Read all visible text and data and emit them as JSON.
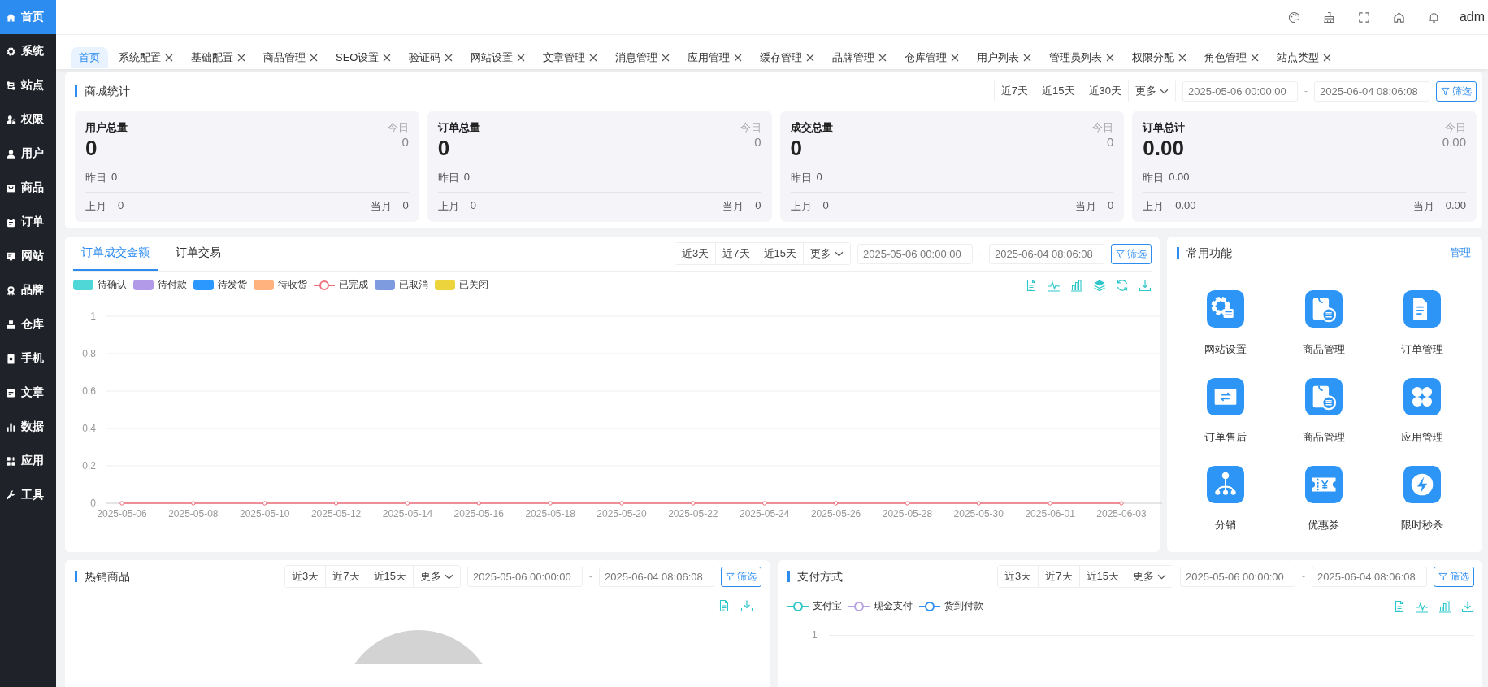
{
  "sidebar": {
    "items": [
      {
        "label": "首页",
        "selected": true
      },
      {
        "label": "系统",
        "selected": false
      },
      {
        "label": "站点",
        "selected": false
      },
      {
        "label": "权限",
        "selected": false
      },
      {
        "label": "用户",
        "selected": false
      },
      {
        "label": "商品",
        "selected": false
      },
      {
        "label": "订单",
        "selected": false
      },
      {
        "label": "网站",
        "selected": false
      },
      {
        "label": "品牌",
        "selected": false
      },
      {
        "label": "仓库",
        "selected": false
      },
      {
        "label": "手机",
        "selected": false
      },
      {
        "label": "文章",
        "selected": false
      },
      {
        "label": "数据",
        "selected": false
      },
      {
        "label": "应用",
        "selected": false
      },
      {
        "label": "工具",
        "selected": false
      }
    ]
  },
  "header": {
    "user": "adm"
  },
  "tabs": [
    {
      "label": "首页",
      "selected": true,
      "closable": false
    },
    {
      "label": "系统配置",
      "selected": false,
      "closable": true
    },
    {
      "label": "基础配置",
      "selected": false,
      "closable": true
    },
    {
      "label": "商品管理",
      "selected": false,
      "closable": true
    },
    {
      "label": "SEO设置",
      "selected": false,
      "closable": true
    },
    {
      "label": "验证码",
      "selected": false,
      "closable": true
    },
    {
      "label": "网站设置",
      "selected": false,
      "closable": true
    },
    {
      "label": "文章管理",
      "selected": false,
      "closable": true
    },
    {
      "label": "消息管理",
      "selected": false,
      "closable": true
    },
    {
      "label": "应用管理",
      "selected": false,
      "closable": true
    },
    {
      "label": "缓存管理",
      "selected": false,
      "closable": true
    },
    {
      "label": "品牌管理",
      "selected": false,
      "closable": true
    },
    {
      "label": "仓库管理",
      "selected": false,
      "closable": true
    },
    {
      "label": "用户列表",
      "selected": false,
      "closable": true
    },
    {
      "label": "管理员列表",
      "selected": false,
      "closable": true
    },
    {
      "label": "权限分配",
      "selected": false,
      "closable": true
    },
    {
      "label": "角色管理",
      "selected": false,
      "closable": true
    },
    {
      "label": "站点类型",
      "selected": false,
      "closable": true
    }
  ],
  "mall_stats": {
    "title": "商城统计",
    "filter": {
      "ranges": [
        "近7天",
        "近15天",
        "近30天"
      ],
      "more": "更多",
      "start": "2025-05-06 00:00:00",
      "separator": "-",
      "end": "2025-06-04 08:06:08",
      "button": "筛选"
    },
    "cards": [
      {
        "title": "用户总量",
        "value": "0",
        "today_label": "今日",
        "today": "0",
        "yesterday_label": "昨日",
        "yesterday": "0",
        "last_month_label": "上月",
        "last_month": "0",
        "this_month_label": "当月",
        "this_month": "0"
      },
      {
        "title": "订单总量",
        "value": "0",
        "today_label": "今日",
        "today": "0",
        "yesterday_label": "昨日",
        "yesterday": "0",
        "last_month_label": "上月",
        "last_month": "0",
        "this_month_label": "当月",
        "this_month": "0"
      },
      {
        "title": "成交总量",
        "value": "0",
        "today_label": "今日",
        "today": "0",
        "yesterday_label": "昨日",
        "yesterday": "0",
        "last_month_label": "上月",
        "last_month": "0",
        "this_month_label": "当月",
        "this_month": "0"
      },
      {
        "title": "订单总计",
        "value": "0.00",
        "today_label": "今日",
        "today": "0.00",
        "yesterday_label": "昨日",
        "yesterday": "0.00",
        "last_month_label": "上月",
        "last_month": "0.00",
        "this_month_label": "当月",
        "this_month": "0.00"
      }
    ]
  },
  "order_chart": {
    "tabs": [
      {
        "label": "订单成交金额",
        "selected": true
      },
      {
        "label": "订单交易",
        "selected": false
      }
    ],
    "filter": {
      "ranges": [
        "近3天",
        "近7天",
        "近15天"
      ],
      "more": "更多",
      "start": "2025-05-06 00:00:00",
      "separator": "-",
      "end": "2025-06-04 08:06:08",
      "button": "筛选"
    },
    "legend": [
      {
        "kind": "swatch",
        "label": "待确认",
        "color": "#4fd6d6"
      },
      {
        "kind": "swatch",
        "label": "待付款",
        "color": "#b39ae8"
      },
      {
        "kind": "swatch",
        "label": "待发货",
        "color": "#2b98ff"
      },
      {
        "kind": "swatch",
        "label": "待收货",
        "color": "#ffb27e"
      },
      {
        "kind": "line"
      },
      {
        "kind": "swatch",
        "label": "已取消",
        "color": "#7f9be0"
      },
      {
        "kind": "swatch",
        "label": "已关闭",
        "color": "#ecd53c"
      }
    ],
    "chart_data": {
      "type": "line",
      "ylim": [
        0,
        1
      ],
      "yticks": [
        0,
        0.2,
        0.4,
        0.6,
        0.8,
        1
      ],
      "grid": true,
      "categories": [
        "2025-05-06",
        "2025-05-08",
        "2025-05-10",
        "2025-05-12",
        "2025-05-14",
        "2025-05-16",
        "2025-05-18",
        "2025-05-20",
        "2025-05-22",
        "2025-05-24",
        "2025-05-26",
        "2025-05-28",
        "2025-05-30",
        "2025-06-01",
        "2025-06-03"
      ],
      "series": [
        {
          "name": "已完成",
          "color": "#f0707e",
          "marker": "circle",
          "values": [
            0,
            0,
            0,
            0,
            0,
            0,
            0,
            0,
            0,
            0,
            0,
            0,
            0,
            0,
            0
          ]
        }
      ]
    }
  },
  "shortcuts": {
    "title": "常用功能",
    "manage_link": "管理",
    "items": [
      {
        "label": "网站设置"
      },
      {
        "label": "商品管理"
      },
      {
        "label": "订单管理"
      },
      {
        "label": "订单售后"
      },
      {
        "label": "商品管理"
      },
      {
        "label": "应用管理"
      },
      {
        "label": "分销"
      },
      {
        "label": "优惠券"
      },
      {
        "label": "限时秒杀"
      }
    ]
  },
  "hot_products": {
    "title": "热销商品",
    "filter": {
      "ranges": [
        "近3天",
        "近7天",
        "近15天"
      ],
      "more": "更多",
      "start": "2025-05-06 00:00:00",
      "separator": "-",
      "end": "2025-06-04 08:06:08",
      "button": "筛选"
    }
  },
  "payment": {
    "title": "支付方式",
    "filter": {
      "ranges": [
        "近3天",
        "近7天",
        "近15天"
      ],
      "more": "更多",
      "start": "2025-05-06 00:00:00",
      "separator": "-",
      "end": "2025-06-04 08:06:08",
      "button": "筛选"
    },
    "legend": [
      {
        "label": "支付宝",
        "color": "#2ec7c9"
      },
      {
        "label": "现金支付",
        "color": "#b6a2de"
      },
      {
        "label": "货到付款",
        "color": "#2f8ff0"
      }
    ],
    "y_label": "1"
  }
}
